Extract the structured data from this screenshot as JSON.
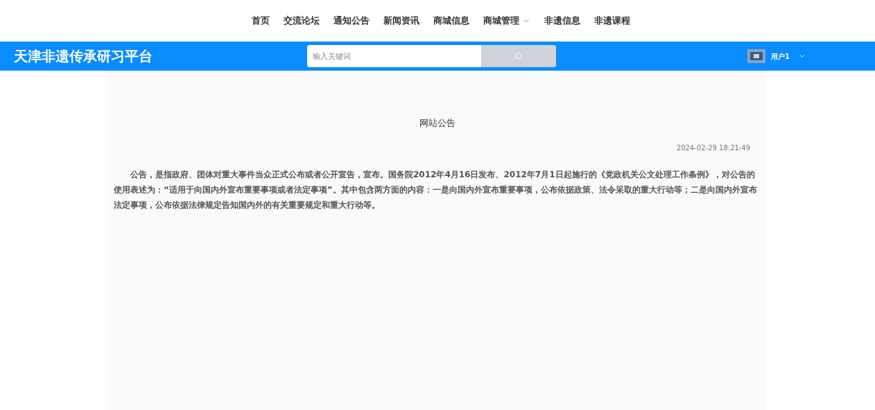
{
  "nav": [
    {
      "label": "首页",
      "kind": "link"
    },
    {
      "label": "交流论坛",
      "kind": "link"
    },
    {
      "label": "通知公告",
      "kind": "link"
    },
    {
      "label": "新闻资讯",
      "kind": "link"
    },
    {
      "label": "商城信息",
      "kind": "link"
    },
    {
      "label": "商城管理",
      "kind": "dropdown"
    },
    {
      "label": "非遗信息",
      "kind": "link"
    },
    {
      "label": "非遗课程",
      "kind": "link"
    }
  ],
  "header": {
    "title": "天津非遗传承研习平台",
    "search": {
      "placeholder": "输入关键词"
    },
    "user": "用户1"
  },
  "notice": {
    "title": "网站公告",
    "date": "2024-02-29 18:21:49",
    "body": "公告，是指政府、团体对重大事件当众正式公布或者公开宣告，宣布。国务院2012年4月16日发布、2012年7月1日起施行的《党政机关公文处理工作条例》，对公告的使用表述为：“适用于向国内外宣布重要事项或者法定事项”。其中包含两方面的内容：一是向国内外宣布重要事项，公布依据政策、法令采取的重大行动等；二是向国内外宣布法定事项，公布依据法律规定告知国内外的有关重要规定和重大行动等。"
  }
}
